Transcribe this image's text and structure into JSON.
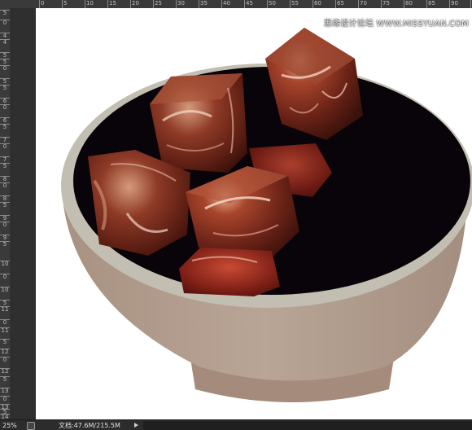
{
  "ruler": {
    "top_ticks": [
      "0",
      "5",
      "10",
      "15",
      "20",
      "25",
      "30",
      "35",
      "40",
      "45",
      "50",
      "55",
      "60",
      "65",
      "70",
      "75",
      "80",
      "85",
      "90",
      "95"
    ],
    "left_ticks": [
      "5",
      "0",
      "4",
      "4",
      "5",
      "5",
      "0",
      "5",
      "5",
      "6",
      "0",
      "6",
      "5",
      "7",
      "0",
      "7",
      "5",
      "8",
      "0",
      "8",
      "5",
      "9",
      "0",
      "9",
      "5",
      "10",
      "0",
      "10",
      "5",
      "11",
      "0",
      "11",
      "5",
      "12",
      "0",
      "12",
      "5",
      "13",
      "0",
      "13",
      "5",
      "14",
      "0"
    ]
  },
  "canvas": {
    "watermark": "思缘设计论坛 WWW.MISSYUAN.COM",
    "bowl_rim_color": "#c2bfb2",
    "bowl_body_color": "#b09e8f",
    "bowl_interior_color": "#08040a",
    "meat_color": "#7a2e1e"
  },
  "statusbar": {
    "zoom": "25%",
    "doc_info": "文档:47.6M/215.5M"
  }
}
